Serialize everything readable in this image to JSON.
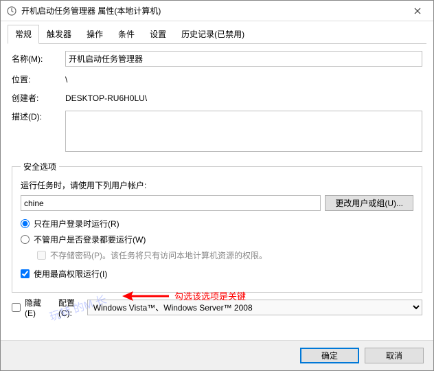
{
  "window": {
    "title": "开机启动任务管理器 属性(本地计算机)"
  },
  "tabs": {
    "general": "常规",
    "triggers": "触发器",
    "actions": "操作",
    "conditions": "条件",
    "settings": "设置",
    "history": "历史记录(已禁用)"
  },
  "fields": {
    "name_label": "名称(M):",
    "name_value": "开机启动任务管理器",
    "location_label": "位置:",
    "location_value": "\\",
    "creator_label": "创建者:",
    "creator_value": "DESKTOP-RU6H0LU\\",
    "description_label": "描述(D):",
    "description_value": ""
  },
  "security": {
    "legend": "安全选项",
    "prompt": "运行任务时，请使用下列用户帐户:",
    "account_value": "chine",
    "change_user_button": "更改用户或组(U)...",
    "radio_logged_on": "只在用户登录时运行(R)",
    "radio_any_time": "不管用户是否登录都要运行(W)",
    "no_store_pwd": "不存储密码(P)。该任务将只有访问本地计算机资源的权限。",
    "highest_priv": "使用最高权限运行(I)"
  },
  "bottom": {
    "hidden_label": "隐藏(E)",
    "configure_label": "配置(C):",
    "configure_value": "Windows Vista™、Windows Server™ 2008"
  },
  "buttons": {
    "ok": "确定",
    "cancel": "取消"
  },
  "annotation": {
    "text": "勾选该选项是关键"
  },
  "watermark": "玩转      的M   长"
}
